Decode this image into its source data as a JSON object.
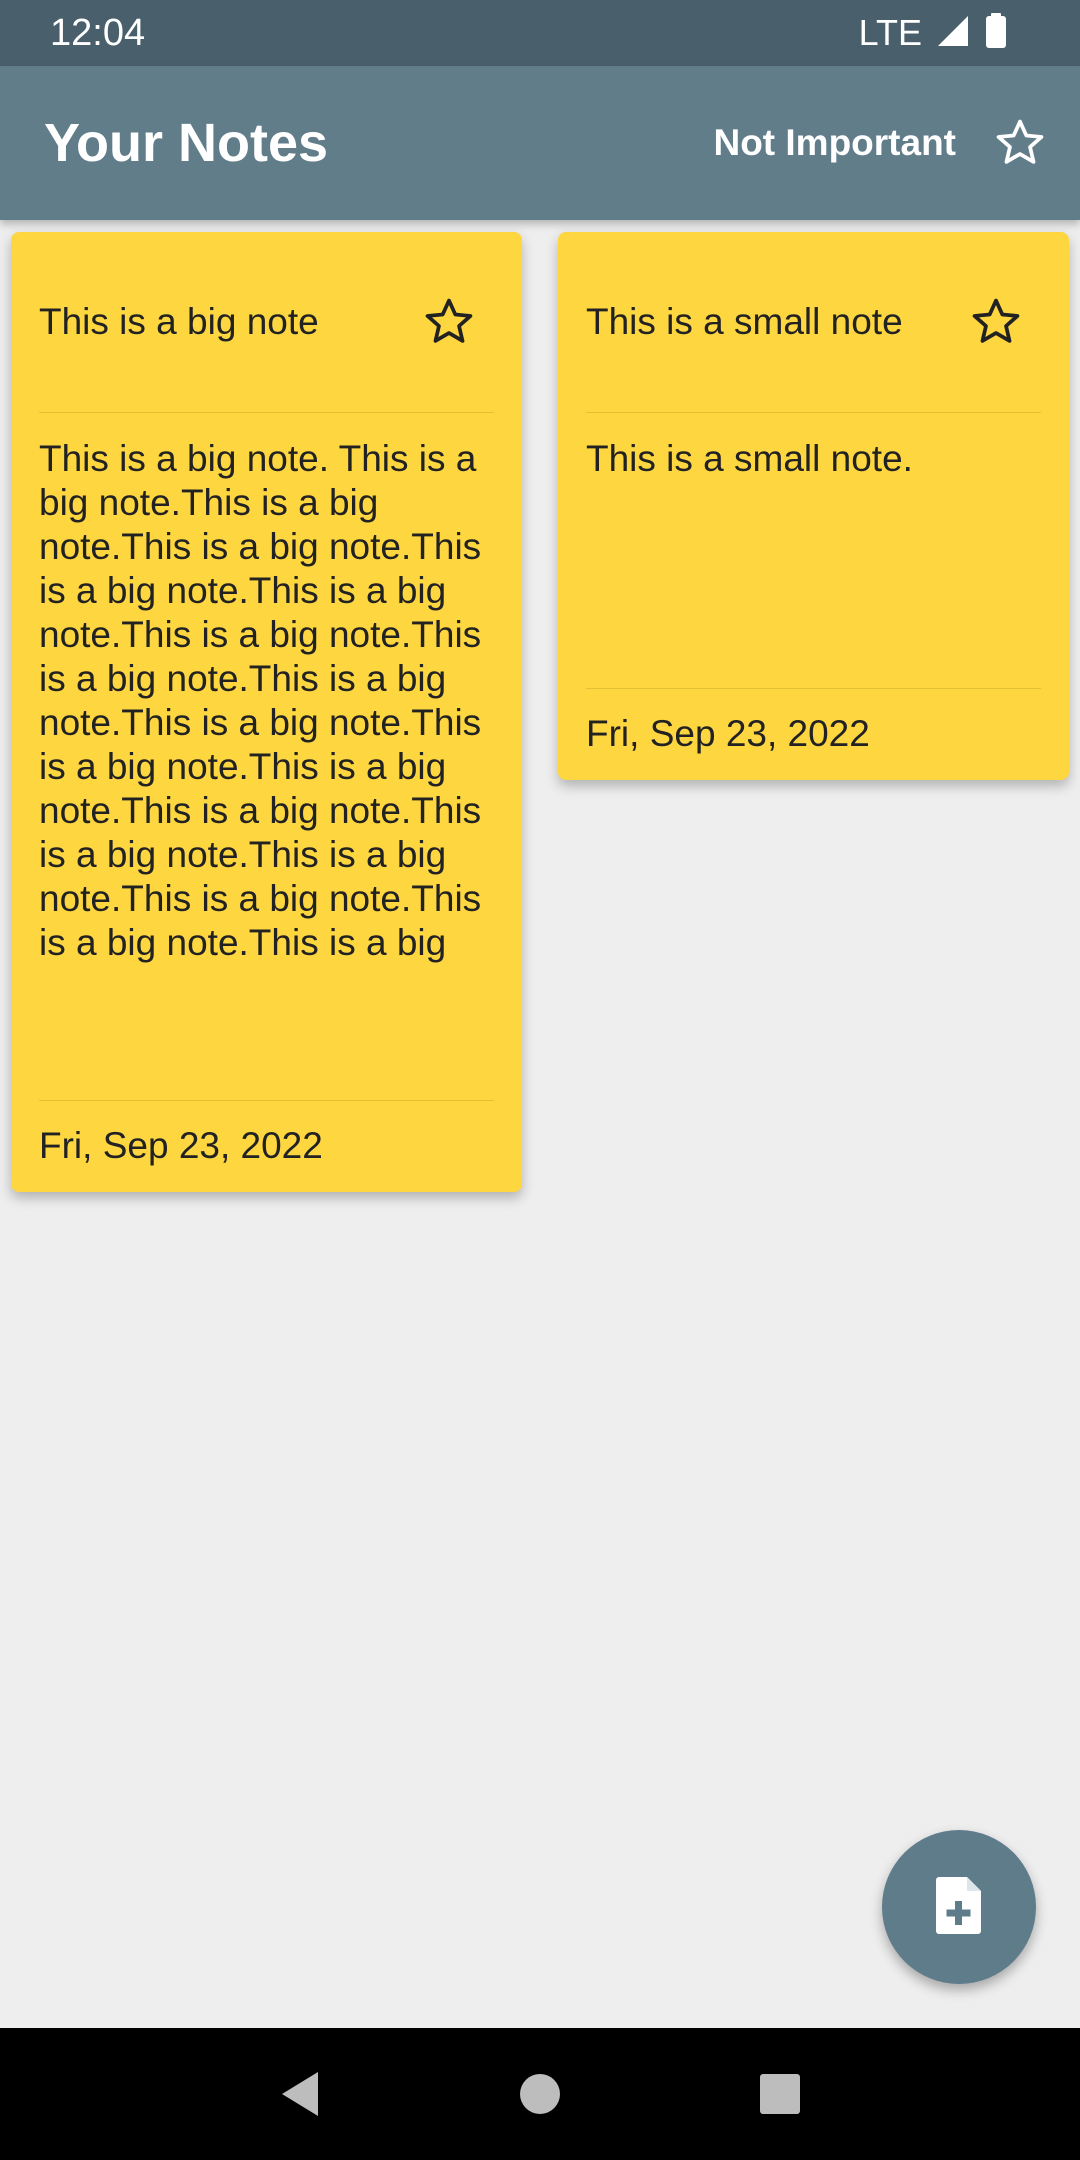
{
  "status_bar": {
    "time": "12:04",
    "network": "LTE",
    "icons": [
      "signal-icon",
      "battery-icon"
    ]
  },
  "app_bar": {
    "title": "Your Notes",
    "filter_label": "Not Important",
    "filter_icon": "star-outline-icon",
    "color": "#617d8a"
  },
  "notes": [
    {
      "title": "This is a big note",
      "body": "This is a big note. This is a big note.This is a big note.This is a big note.This is a big note.This is a big note.This is a big note.This is a big note.This is a big note.This is a big note.This is a big note.This is a big note.This is a big note.This is a big note.This is a big note.This is a big note.This is a big note.This is a big",
      "date": "Fri, Sep 23, 2022",
      "important_icon": "star-outline-icon",
      "color": "#fed640"
    },
    {
      "title": "This is a small note",
      "body": "This is a small note.",
      "date": "Fri, Sep 23, 2022",
      "important_icon": "star-outline-icon",
      "color": "#fed640"
    }
  ],
  "fab": {
    "icon": "add-note-icon",
    "color": "#5f7c8b"
  },
  "nav_bar": {
    "icons": [
      "back-icon",
      "home-icon",
      "recents-icon"
    ]
  }
}
